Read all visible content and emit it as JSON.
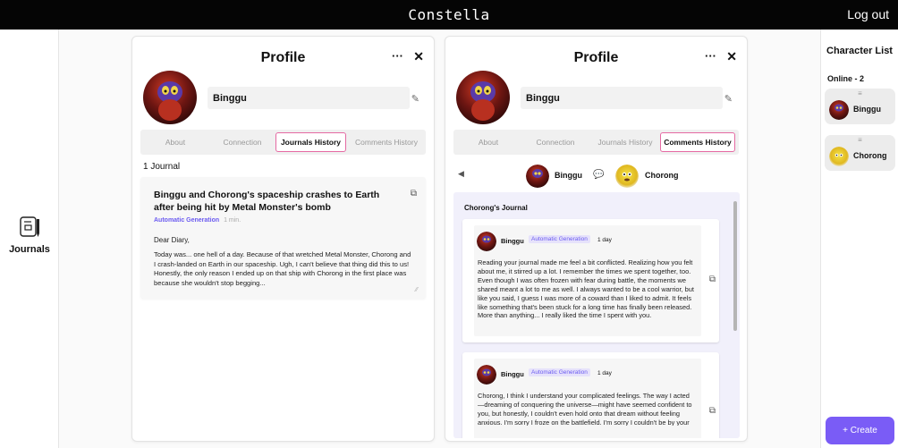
{
  "app": {
    "title": "Constella",
    "logout_label": "Log out"
  },
  "left_nav": {
    "journals_label": "Journals"
  },
  "character_list": {
    "title": "Character List",
    "online_label": "Online - 2",
    "items": [
      {
        "name": "Binggu",
        "grip": "≡"
      },
      {
        "name": "Chorong",
        "grip": "≡"
      }
    ],
    "create_label": "+ Create"
  },
  "panels": [
    {
      "title": "Profile",
      "more": "···",
      "close": "✕",
      "name": "Binggu",
      "tabs": [
        "About",
        "Connection",
        "Journals History",
        "Comments History"
      ],
      "active_tab": "Journals History",
      "journal_count": "1 Journal",
      "journal": {
        "title": "Binggu and Chorong's spaceship crashes to Earth after being hit by Metal Monster's bomb",
        "tag": "Automatic Generation",
        "time": "1 min.",
        "greeting": "Dear Diary,",
        "body": "Today was... one hell of a day. Because of that wretched Metal Monster, Chorong and I crash-landed on Earth in our spaceship. Ugh, I can't believe that thing did this to us! Honestly, the only reason I ended up on that ship with Chorong in the first place was because she wouldn't stop begging..."
      }
    },
    {
      "title": "Profile",
      "more": "···",
      "close": "✕",
      "name": "Binggu",
      "tabs": [
        "About",
        "Connection",
        "Journals History",
        "Comments History"
      ],
      "active_tab": "Comments History",
      "pair": {
        "from": "Binggu",
        "to": "Chorong"
      },
      "comments_heading": "Chorong's Journal",
      "comments": [
        {
          "author": "Binggu",
          "tag": "Automatic Generation",
          "time": "1 day",
          "text": "Reading your journal made me feel a bit conflicted. Realizing how you felt about me, it stirred up a lot. I remember the times we spent together, too. Even though I was often frozen with fear during battle, the moments we shared meant a lot to me as well. I always wanted to be a cool warrior, but like you said, I guess I was more of a coward than I liked to admit. It feels like something that's been stuck for a long time has finally been released. More than anything... I really liked the time I spent with you."
        },
        {
          "author": "Binggu",
          "tag": "Automatic Generation",
          "time": "1 day",
          "text": "Chorong, I think I understand your complicated feelings. The way I acted—dreaming of conquering the universe—might have seemed confident to you, but honestly, I couldn't even hold onto that dream without feeling anxious. I'm sorry I froze on the battlefield. I'm sorry I couldn't be by your side like I should have. The truth is..."
        }
      ]
    }
  ],
  "colors": {
    "accent": "#7a5cf6",
    "tab_border": "#e56aa3",
    "topbar": "#050505",
    "tag": "#6b5bf0"
  },
  "icons": {
    "journal": "journal-icon",
    "pencil": "pencil-icon",
    "external": "external-link-icon",
    "comment": "speech-bubble-icon",
    "prev": "triangle-left-icon"
  }
}
